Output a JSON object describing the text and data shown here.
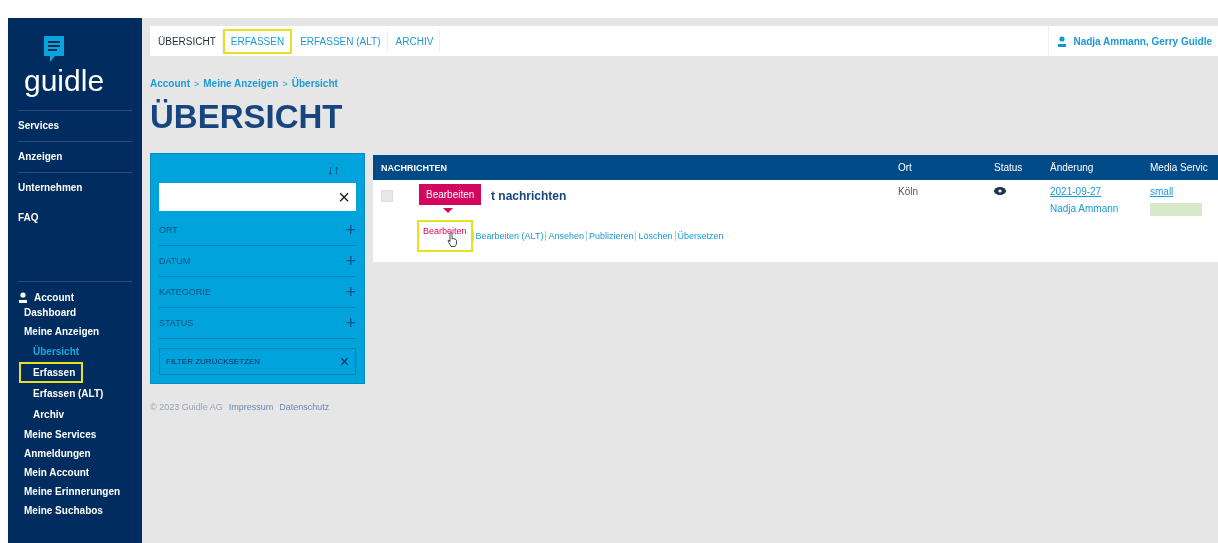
{
  "logo": {
    "text": "guidle"
  },
  "sidebar": {
    "main_items": [
      {
        "label": "Services"
      },
      {
        "label": "Anzeigen"
      },
      {
        "label": "Unternehmen"
      },
      {
        "label": "FAQ"
      }
    ],
    "account": {
      "label": "Account",
      "items": [
        {
          "label": "Dashboard",
          "selected": false,
          "highlighted": false
        },
        {
          "label": "Meine Anzeigen",
          "selected": false,
          "highlighted": false,
          "children": [
            {
              "label": "Übersicht",
              "selected": true,
              "highlighted": false
            },
            {
              "label": "Erfassen",
              "selected": false,
              "highlighted": true
            },
            {
              "label": "Erfassen (ALT)",
              "selected": false,
              "highlighted": false
            },
            {
              "label": "Archiv",
              "selected": false,
              "highlighted": false
            }
          ]
        },
        {
          "label": "Meine Services",
          "selected": false,
          "highlighted": false
        },
        {
          "label": "Anmeldungen",
          "selected": false,
          "highlighted": false
        },
        {
          "label": "Mein Account",
          "selected": false,
          "highlighted": false
        },
        {
          "label": "Meine Erinnerungen",
          "selected": false,
          "highlighted": false
        },
        {
          "label": "Meine Suchabos",
          "selected": false,
          "highlighted": false
        }
      ]
    }
  },
  "tabs": [
    {
      "label": "ÜBERSICHT",
      "selected": true,
      "highlighted": false
    },
    {
      "label": "ERFASSEN",
      "selected": false,
      "highlighted": true
    },
    {
      "label": "ERFASSEN (ALT)",
      "selected": false,
      "highlighted": false
    },
    {
      "label": "ARCHIV",
      "selected": false,
      "highlighted": false
    }
  ],
  "user": "Nadja Ammann, Gerry Guidle",
  "breadcrumb": [
    "Account",
    "Meine Anzeigen",
    "Übersicht"
  ],
  "breadcrumb_separator": ">",
  "page_title": "ÜBERSICHT",
  "filter": {
    "sort_icon": "↓↑",
    "search_clear": "×",
    "sections": [
      {
        "label": "ORT",
        "toggle": "+"
      },
      {
        "label": "DATUM",
        "toggle": "+"
      },
      {
        "label": "KATEGORIE",
        "toggle": "+"
      },
      {
        "label": "STATUS",
        "toggle": "+"
      }
    ],
    "reset": {
      "label": "FILTER ZURÜCKSETZEN",
      "icon": "×"
    }
  },
  "table": {
    "columns": [
      "NACHRICHTEN",
      "Ort",
      "Status",
      "Änderung",
      "Media Servic"
    ],
    "rows": [
      {
        "checked": false,
        "title": "t nachrichten",
        "ort": "Köln",
        "changed_date": "2021-09-27",
        "changed_by": "Nadja Ammann",
        "media": "small",
        "tooltip": "Bearbeiten",
        "actions": [
          {
            "label": "Bearbeiten",
            "hovered": true,
            "highlighted": true
          },
          {
            "label": "Bearbeiten (ALT)",
            "hovered": false,
            "highlighted": false
          },
          {
            "label": "Ansehen",
            "hovered": false,
            "highlighted": false
          },
          {
            "label": "Publizieren",
            "hovered": false,
            "highlighted": false
          },
          {
            "label": "Löschen",
            "hovered": false,
            "highlighted": false
          },
          {
            "label": "Übersetzen",
            "hovered": false,
            "highlighted": false
          }
        ]
      }
    ]
  },
  "footer": {
    "copyright": "© 2023 Guidle AG",
    "links": [
      "Impressum",
      "Datenschutz"
    ]
  }
}
